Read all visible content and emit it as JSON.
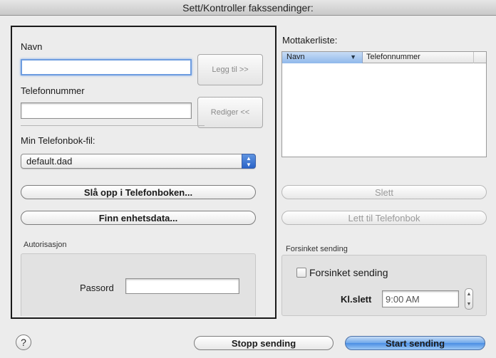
{
  "window": {
    "title": "Sett/Kontroller fakssendinger:"
  },
  "entry": {
    "name_label": "Navn",
    "name_value": "",
    "phone_label": "Telefonnummer",
    "phone_value": "",
    "add_button": "Legg til >>",
    "edit_button": "Rediger <<"
  },
  "phonebook": {
    "file_label": "Min Telefonbok-fil:",
    "file_selected": "default.dad",
    "lookup_button": "Slå opp i Telefonboken...",
    "device_button": "Finn enhetsdata..."
  },
  "auth": {
    "group_label": "Autorisasjon",
    "password_label": "Passord",
    "password_value": ""
  },
  "recipients": {
    "label": "Mottakerliste:",
    "columns": [
      "Navn",
      "Telefonnummer"
    ],
    "rows": [],
    "delete_button": "Slett",
    "add_to_phonebook_button": "Lett til Telefonbok"
  },
  "delayed": {
    "group_label": "Forsinket sending",
    "checkbox_label": "Forsinket sending",
    "checked": false,
    "time_label": "Kl.slett",
    "time_value": "9:00 AM"
  },
  "footer": {
    "help": "?",
    "stop_button": "Stopp sending",
    "start_button": "Start sending"
  }
}
